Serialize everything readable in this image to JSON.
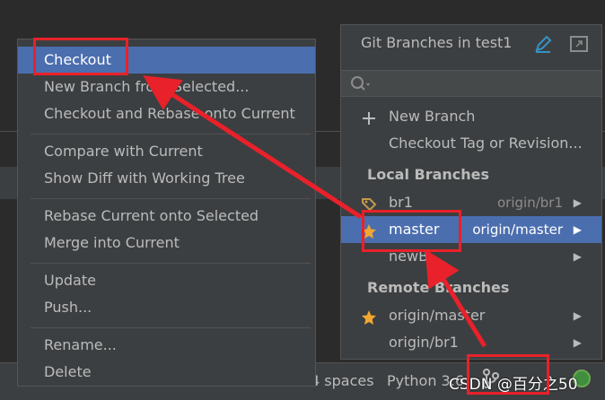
{
  "context_menu": {
    "items": [
      {
        "label": "Checkout"
      },
      {
        "label": "New Branch from Selected..."
      },
      {
        "label": "Checkout and Rebase onto Current"
      },
      {
        "label": "Compare with Current"
      },
      {
        "label": "Show Diff with Working Tree"
      },
      {
        "label": "Rebase Current onto Selected"
      },
      {
        "label": "Merge into Current"
      },
      {
        "label": "Update"
      },
      {
        "label": "Push..."
      },
      {
        "label": "Rename..."
      },
      {
        "label": "Delete"
      }
    ]
  },
  "popup": {
    "title": "Git Branches in test1",
    "actions": [
      {
        "label": "New Branch",
        "icon": "plus-icon"
      },
      {
        "label": "Checkout Tag or Revision..."
      }
    ],
    "local_header": "Local Branches",
    "local_branches": [
      {
        "name": "br1",
        "tracking": "origin/br1",
        "icon": "tag-icon"
      },
      {
        "name": "master",
        "tracking": "origin/master",
        "icon": "star-icon"
      },
      {
        "name": "newB",
        "tracking": ""
      }
    ],
    "remote_header": "Remote Branches",
    "remote_branches": [
      {
        "name": "origin/master",
        "icon": "star-icon"
      },
      {
        "name": "origin/br1"
      }
    ]
  },
  "statusbar": {
    "indent": "4 spaces",
    "interpreter": "Python 3.6",
    "watermark": "CSDN @百分之50"
  },
  "colors": {
    "selection": "#4b6eaf",
    "annotation": "#e8212a",
    "star": "#f0a732",
    "tag": "#c49a4c"
  }
}
